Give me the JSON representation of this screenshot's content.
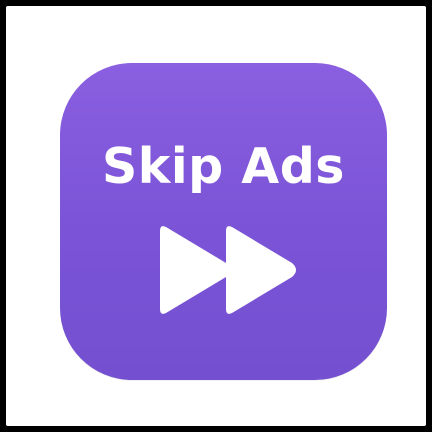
{
  "app_icon": {
    "label": "Skip Ads",
    "icon": "fast-forward-icon",
    "colors": {
      "background_top": "#8a5fe0",
      "background_bottom": "#7450d0",
      "foreground": "#ffffff",
      "page_background": "#ffffff",
      "frame": "#000000"
    }
  }
}
